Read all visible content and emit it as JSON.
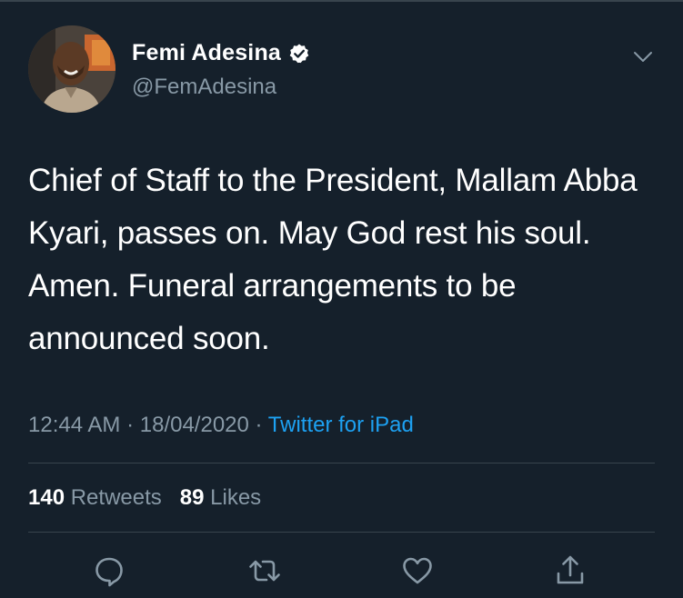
{
  "tweet": {
    "author": {
      "display_name": "Femi Adesina",
      "handle": "@FemAdesina",
      "verified": true
    },
    "text": "Chief of Staff to the President, Mallam Abba Kyari, passes on. May God rest his soul. Amen. Funeral arrangements to be announced soon.",
    "time": "12:44 AM",
    "date": "18/04/2020",
    "separator": "·",
    "source": "Twitter for iPad",
    "retweets": {
      "count": "140",
      "label": "Retweets"
    },
    "likes": {
      "count": "89",
      "label": "Likes"
    }
  },
  "icons": {
    "verified": "verified-badge-icon",
    "more": "chevron-down-icon",
    "reply": "reply-icon",
    "retweet": "retweet-icon",
    "like": "heart-icon",
    "share": "share-icon"
  },
  "colors": {
    "background": "#15202b",
    "text": "#ffffff",
    "secondary_text": "#8899a6",
    "link": "#1da1f2",
    "divider": "#38444d"
  }
}
